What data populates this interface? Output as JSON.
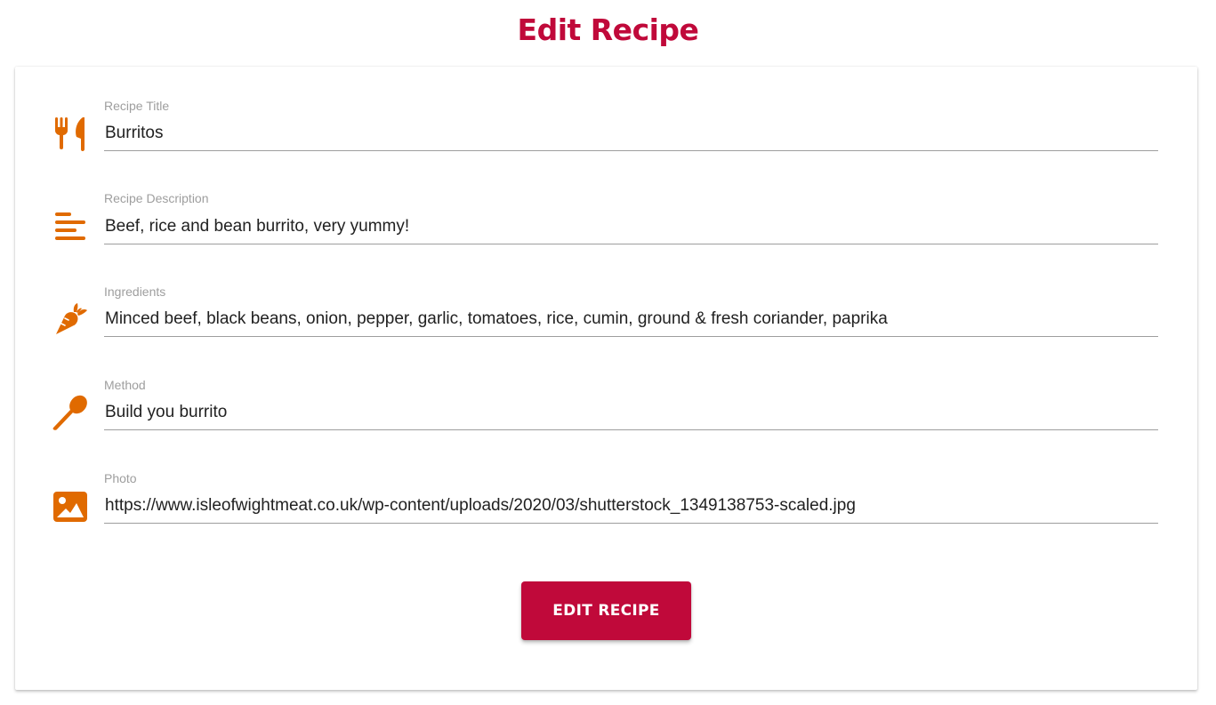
{
  "page": {
    "title": "Edit Recipe"
  },
  "colors": {
    "accent": "#c0093a",
    "icon": "#e06a00",
    "label": "#9e9e9e",
    "text": "#212121"
  },
  "form": {
    "fields": [
      {
        "label": "Recipe Title",
        "value": "Burritos",
        "icon": "fork-knife-icon"
      },
      {
        "label": "Recipe Description",
        "value": "Beef, rice and bean burrito, very yummy!",
        "icon": "text-align-left-icon"
      },
      {
        "label": "Ingredients",
        "value": "Minced beef, black beans, onion, pepper, garlic, tomatoes, rice, cumin, ground & fresh coriander, paprika",
        "icon": "carrot-icon"
      },
      {
        "label": "Method",
        "value": "Build you burrito",
        "icon": "spoon-icon"
      },
      {
        "label": "Photo",
        "value": "https://www.isleofwightmeat.co.uk/wp-content/uploads/2020/03/shutterstock_1349138753-scaled.jpg",
        "icon": "image-icon"
      }
    ],
    "submit_label": "EDIT RECIPE"
  }
}
